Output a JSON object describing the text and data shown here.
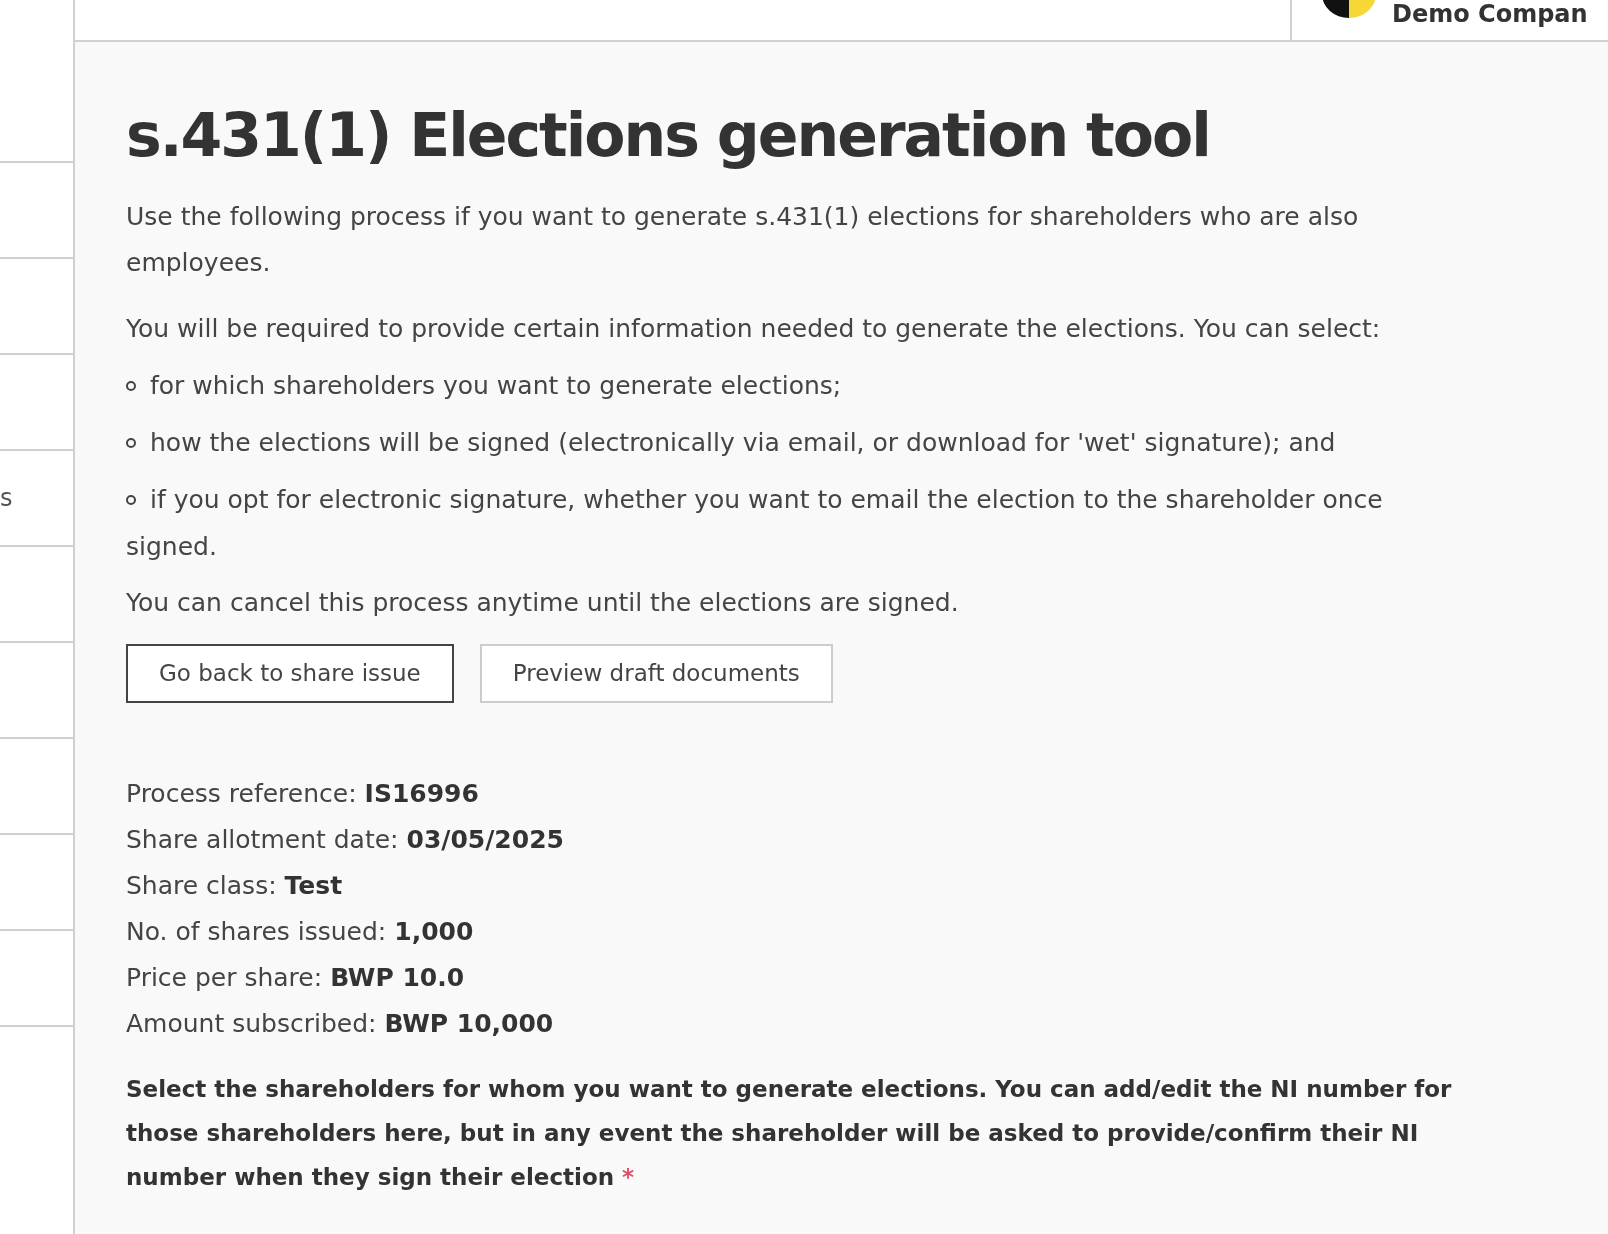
{
  "header": {
    "company": "Demo Compan"
  },
  "sidebar": {
    "item_label": "s"
  },
  "title": "s.431(1) Elections generation tool",
  "intro": [
    "Use the following process if you want to generate s.431(1) elections for shareholders who are also employees.",
    "You will be required to provide certain information needed to generate the elections. You can select:"
  ],
  "bullets": [
    "for which shareholders you want to generate elections;",
    "how the elections will be signed (electronically via email, or download for 'wet' signature); and",
    "if you opt for electronic signature, whether you want to email the election to the shareholder once signed."
  ],
  "note": "You can cancel this process anytime until the elections are signed.",
  "buttons": [
    {
      "label": "Go back to share issue",
      "kind": "primary"
    },
    {
      "label": "Preview draft documents",
      "kind": "secondary"
    }
  ],
  "details": [
    {
      "label": "Process reference:",
      "value": "IS16996"
    },
    {
      "label": "Share allotment date:",
      "value": "03/05/2025"
    },
    {
      "label": "Share class:",
      "value": "Test"
    },
    {
      "label": "No. of shares issued:",
      "value": "1,000"
    },
    {
      "label": "Price per share:",
      "value": "BWP 10.0"
    },
    {
      "label": "Amount subscribed:",
      "value": "BWP 10,000"
    }
  ],
  "select_label": {
    "text": "Select the shareholders for whom you want to generate elections. You can add/edit the NI number for those shareholders here, but in any event the shareholder will be asked to provide/confirm their NI number when they sign their election",
    "required": true,
    "marker": "*"
  }
}
